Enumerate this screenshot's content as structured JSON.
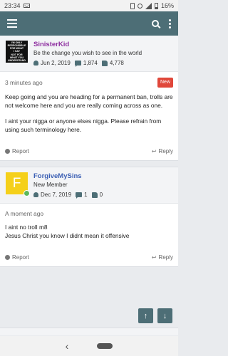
{
  "status_bar": {
    "time": "23:34",
    "battery": "16%"
  },
  "posts": [
    {
      "username": "SinisterKid",
      "user_title": "Be the change you wish to see in the world",
      "join_date": "Jun 2, 2019",
      "message_count": "1,874",
      "reaction_score": "4,778",
      "avatar_text": [
        "I'M ONLY",
        "RESPONSIBLE",
        "FOR WHAT",
        "I SAY",
        "NOT FOR",
        "WHAT YOU",
        "UNDERSTAND"
      ],
      "time_ago": "3 minutes ago",
      "badge": "New",
      "paragraphs": [
        "Keep going and you are heading for a permanent ban, trolls are not welcome here and you are really coming across as one.",
        "I aint your nigga or anyone elses nigga. Please refrain from using such terminology here."
      ],
      "report_label": "Report",
      "reply_label": "Reply"
    },
    {
      "username": "ForgiveMySins",
      "user_title": "New Member",
      "avatar_letter": "F",
      "join_date": "Dec 7, 2019",
      "message_count": "1",
      "reaction_score": "0",
      "time_ago": "A moment ago",
      "paragraphs": [
        "I aint no troll m8\nJesus Christ you know I didnt mean it offensive"
      ],
      "report_label": "Report",
      "reply_label": "Reply"
    }
  ],
  "nav": {
    "up": "↑",
    "down": "↓"
  },
  "colors": {
    "header": "#4d6e76",
    "username1": "#8e2fa0",
    "username2": "#3b5fb4",
    "new_badge": "#e0473a"
  }
}
